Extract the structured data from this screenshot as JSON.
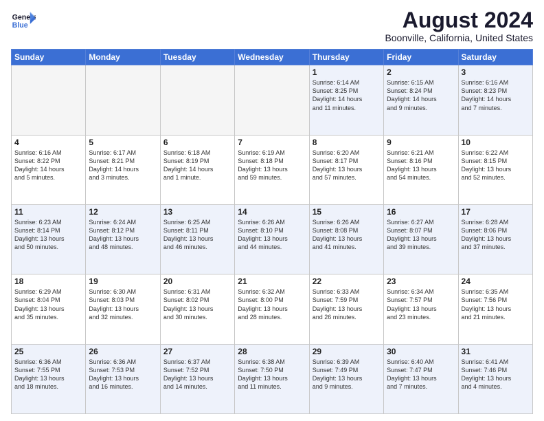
{
  "logo": {
    "line1": "General",
    "line2": "Blue"
  },
  "title": "August 2024",
  "subtitle": "Boonville, California, United States",
  "headers": [
    "Sunday",
    "Monday",
    "Tuesday",
    "Wednesday",
    "Thursday",
    "Friday",
    "Saturday"
  ],
  "weeks": [
    [
      {
        "day": "",
        "info": ""
      },
      {
        "day": "",
        "info": ""
      },
      {
        "day": "",
        "info": ""
      },
      {
        "day": "",
        "info": ""
      },
      {
        "day": "1",
        "info": "Sunrise: 6:14 AM\nSunset: 8:25 PM\nDaylight: 14 hours\nand 11 minutes."
      },
      {
        "day": "2",
        "info": "Sunrise: 6:15 AM\nSunset: 8:24 PM\nDaylight: 14 hours\nand 9 minutes."
      },
      {
        "day": "3",
        "info": "Sunrise: 6:16 AM\nSunset: 8:23 PM\nDaylight: 14 hours\nand 7 minutes."
      }
    ],
    [
      {
        "day": "4",
        "info": "Sunrise: 6:16 AM\nSunset: 8:22 PM\nDaylight: 14 hours\nand 5 minutes."
      },
      {
        "day": "5",
        "info": "Sunrise: 6:17 AM\nSunset: 8:21 PM\nDaylight: 14 hours\nand 3 minutes."
      },
      {
        "day": "6",
        "info": "Sunrise: 6:18 AM\nSunset: 8:19 PM\nDaylight: 14 hours\nand 1 minute."
      },
      {
        "day": "7",
        "info": "Sunrise: 6:19 AM\nSunset: 8:18 PM\nDaylight: 13 hours\nand 59 minutes."
      },
      {
        "day": "8",
        "info": "Sunrise: 6:20 AM\nSunset: 8:17 PM\nDaylight: 13 hours\nand 57 minutes."
      },
      {
        "day": "9",
        "info": "Sunrise: 6:21 AM\nSunset: 8:16 PM\nDaylight: 13 hours\nand 54 minutes."
      },
      {
        "day": "10",
        "info": "Sunrise: 6:22 AM\nSunset: 8:15 PM\nDaylight: 13 hours\nand 52 minutes."
      }
    ],
    [
      {
        "day": "11",
        "info": "Sunrise: 6:23 AM\nSunset: 8:14 PM\nDaylight: 13 hours\nand 50 minutes."
      },
      {
        "day": "12",
        "info": "Sunrise: 6:24 AM\nSunset: 8:12 PM\nDaylight: 13 hours\nand 48 minutes."
      },
      {
        "day": "13",
        "info": "Sunrise: 6:25 AM\nSunset: 8:11 PM\nDaylight: 13 hours\nand 46 minutes."
      },
      {
        "day": "14",
        "info": "Sunrise: 6:26 AM\nSunset: 8:10 PM\nDaylight: 13 hours\nand 44 minutes."
      },
      {
        "day": "15",
        "info": "Sunrise: 6:26 AM\nSunset: 8:08 PM\nDaylight: 13 hours\nand 41 minutes."
      },
      {
        "day": "16",
        "info": "Sunrise: 6:27 AM\nSunset: 8:07 PM\nDaylight: 13 hours\nand 39 minutes."
      },
      {
        "day": "17",
        "info": "Sunrise: 6:28 AM\nSunset: 8:06 PM\nDaylight: 13 hours\nand 37 minutes."
      }
    ],
    [
      {
        "day": "18",
        "info": "Sunrise: 6:29 AM\nSunset: 8:04 PM\nDaylight: 13 hours\nand 35 minutes."
      },
      {
        "day": "19",
        "info": "Sunrise: 6:30 AM\nSunset: 8:03 PM\nDaylight: 13 hours\nand 32 minutes."
      },
      {
        "day": "20",
        "info": "Sunrise: 6:31 AM\nSunset: 8:02 PM\nDaylight: 13 hours\nand 30 minutes."
      },
      {
        "day": "21",
        "info": "Sunrise: 6:32 AM\nSunset: 8:00 PM\nDaylight: 13 hours\nand 28 minutes."
      },
      {
        "day": "22",
        "info": "Sunrise: 6:33 AM\nSunset: 7:59 PM\nDaylight: 13 hours\nand 26 minutes."
      },
      {
        "day": "23",
        "info": "Sunrise: 6:34 AM\nSunset: 7:57 PM\nDaylight: 13 hours\nand 23 minutes."
      },
      {
        "day": "24",
        "info": "Sunrise: 6:35 AM\nSunset: 7:56 PM\nDaylight: 13 hours\nand 21 minutes."
      }
    ],
    [
      {
        "day": "25",
        "info": "Sunrise: 6:36 AM\nSunset: 7:55 PM\nDaylight: 13 hours\nand 18 minutes."
      },
      {
        "day": "26",
        "info": "Sunrise: 6:36 AM\nSunset: 7:53 PM\nDaylight: 13 hours\nand 16 minutes."
      },
      {
        "day": "27",
        "info": "Sunrise: 6:37 AM\nSunset: 7:52 PM\nDaylight: 13 hours\nand 14 minutes."
      },
      {
        "day": "28",
        "info": "Sunrise: 6:38 AM\nSunset: 7:50 PM\nDaylight: 13 hours\nand 11 minutes."
      },
      {
        "day": "29",
        "info": "Sunrise: 6:39 AM\nSunset: 7:49 PM\nDaylight: 13 hours\nand 9 minutes."
      },
      {
        "day": "30",
        "info": "Sunrise: 6:40 AM\nSunset: 7:47 PM\nDaylight: 13 hours\nand 7 minutes."
      },
      {
        "day": "31",
        "info": "Sunrise: 6:41 AM\nSunset: 7:46 PM\nDaylight: 13 hours\nand 4 minutes."
      }
    ]
  ]
}
